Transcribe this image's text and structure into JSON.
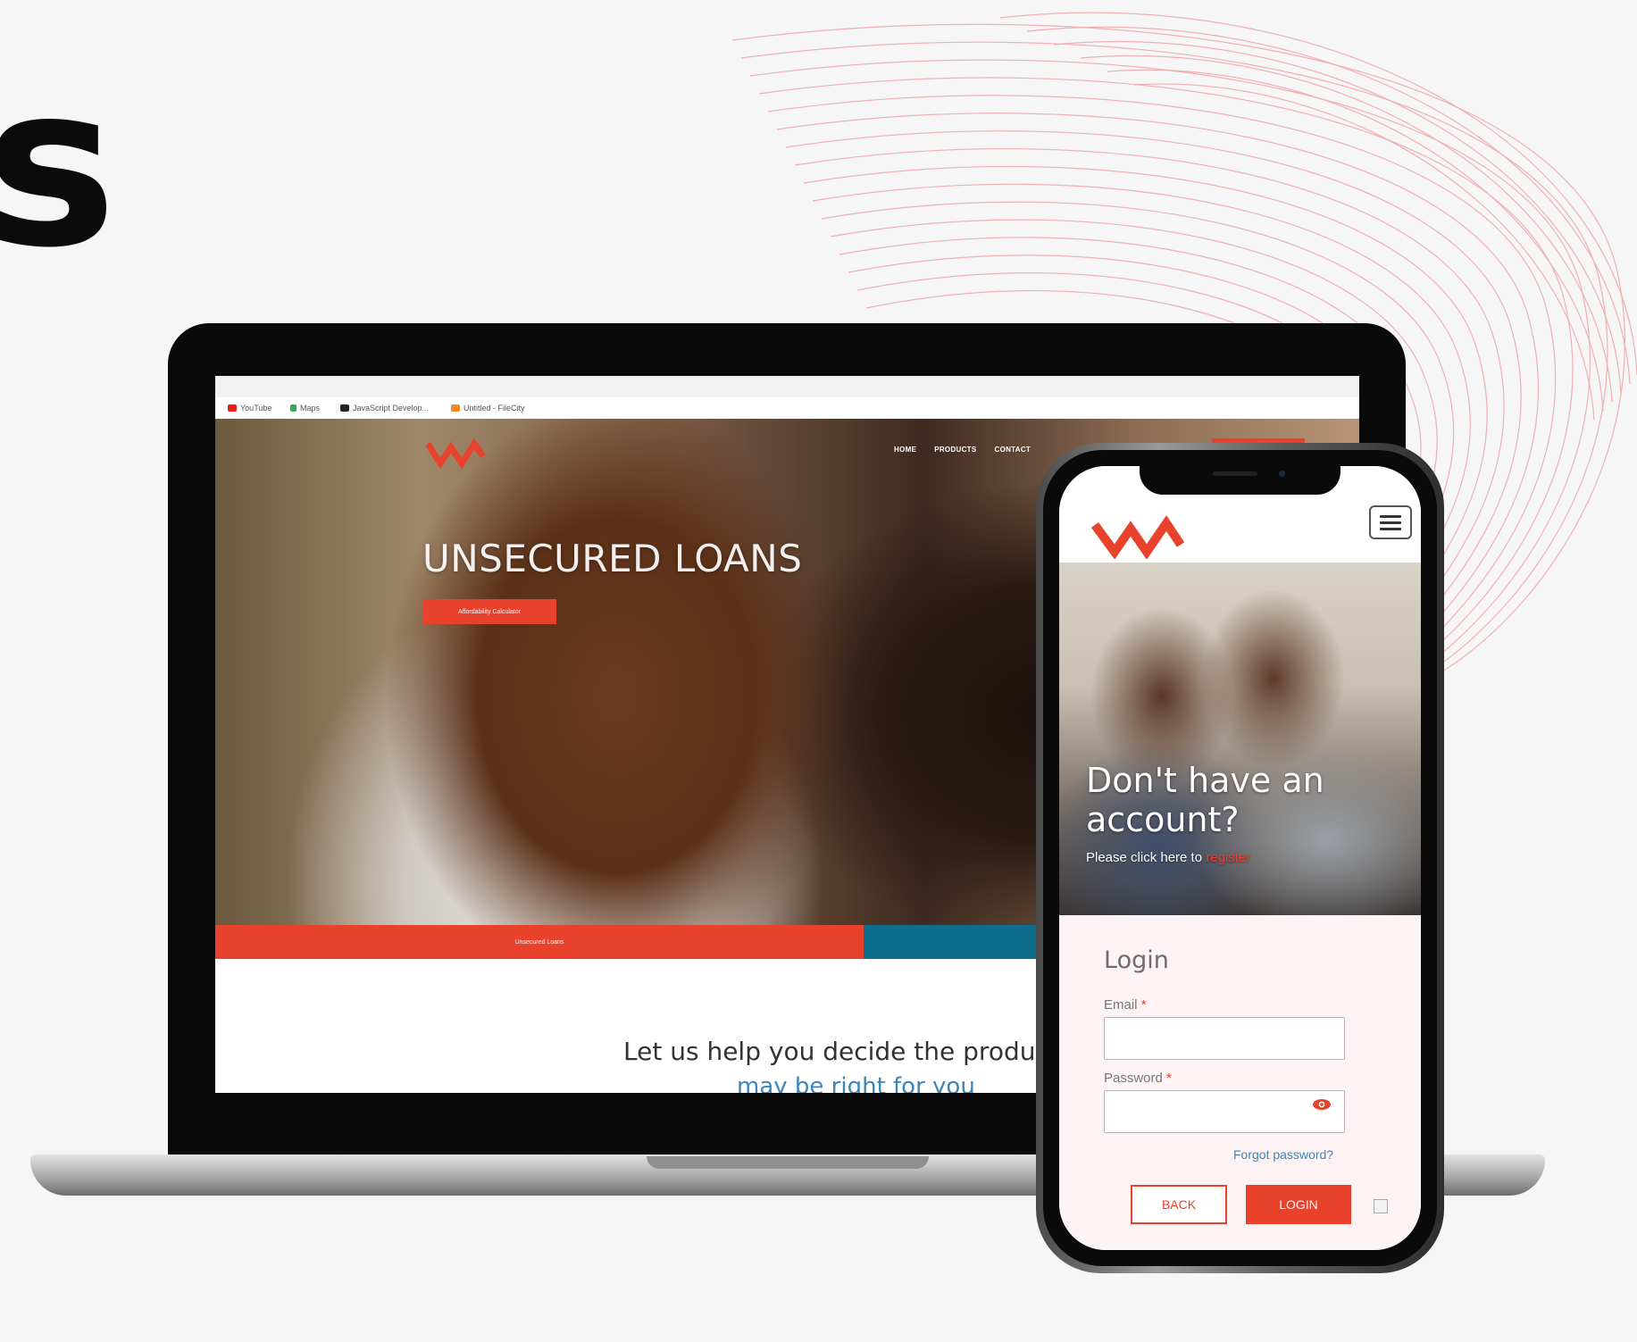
{
  "heading_fragment": "s",
  "desktop": {
    "bookmarks": [
      "YouTube",
      "Maps",
      "JavaScript Develop...",
      "Untitled - FileCity"
    ],
    "nav": [
      "HOME",
      "PRODUCTS",
      "CONTACT"
    ],
    "hero_title": "UNSECURED LOANS",
    "hero_button": "Affordability Calculator",
    "bar_button": "Unsecured Loans",
    "helper_text": "Let us help you decide the produc",
    "helper_text2": "may be right for you"
  },
  "mobile": {
    "hero_title_line1": "Don't have an",
    "hero_title_line2": "account?",
    "hero_sub": "Please click here to",
    "hero_sub_link": "register",
    "login_title": "Login",
    "email_label": "Email",
    "password_label": "Password",
    "required_mark": "*",
    "forgot": "Forgot password?",
    "back_button": "BACK",
    "login_button": "LOGIN"
  },
  "colors": {
    "accent": "#e8412c",
    "teal": "#0f6e8c",
    "link": "#3b86b7"
  },
  "icons": [
    "logo-icon",
    "menu-icon",
    "eye-icon",
    "broken-image-icon"
  ]
}
